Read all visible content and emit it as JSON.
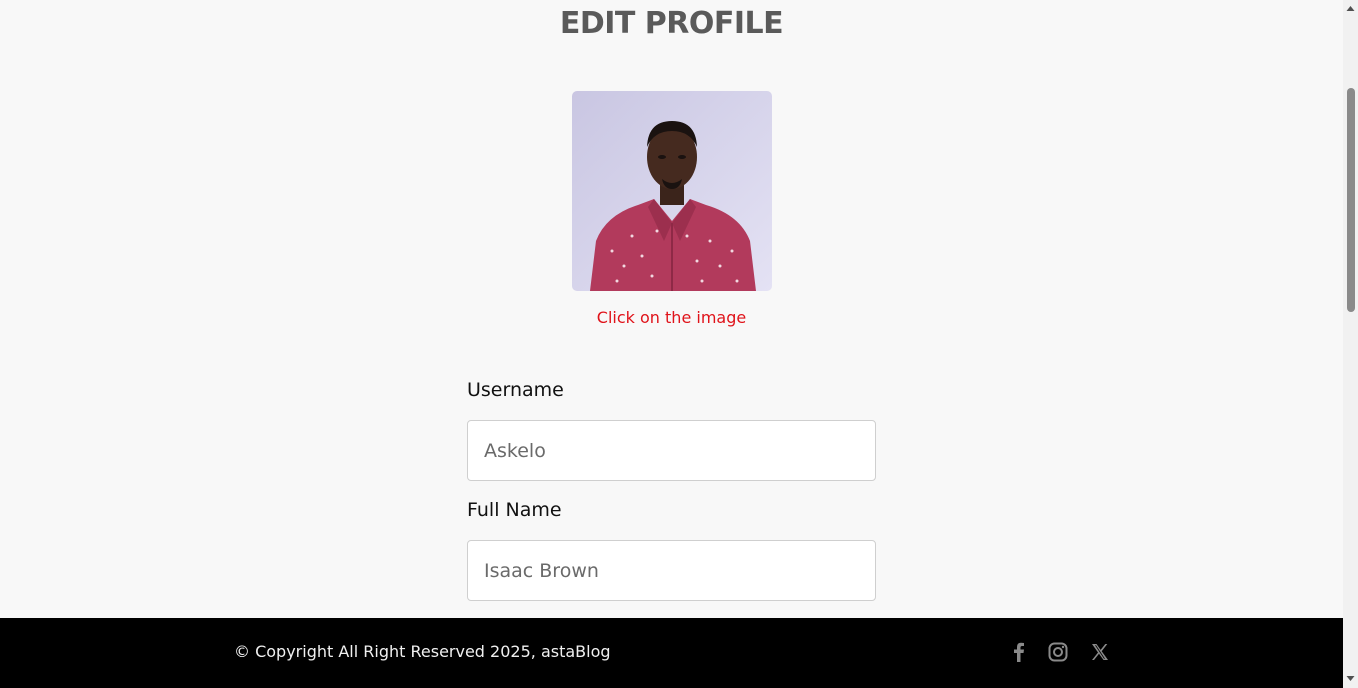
{
  "page": {
    "title": "EDIT PROFILE",
    "image_hint": "Click on the image"
  },
  "form": {
    "username": {
      "label": "Username",
      "value": "Askelo"
    },
    "full_name": {
      "label": "Full Name",
      "value": "Isaac Brown"
    }
  },
  "footer": {
    "copyright": "© Copyright All Right Reserved 2025, astaBlog",
    "social": [
      "facebook-icon",
      "instagram-icon",
      "x-icon"
    ]
  },
  "colors": {
    "hint": "#e0131a",
    "footer_bg": "#000000",
    "title": "#5a5a5a"
  }
}
